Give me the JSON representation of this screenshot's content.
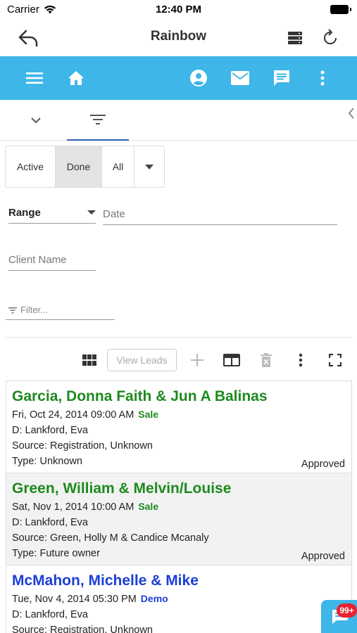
{
  "status_bar": {
    "carrier": "Carrier",
    "time": "12:40 PM"
  },
  "navbar": {
    "title": "Rainbow",
    "icons": [
      "back-icon",
      "server-icon",
      "refresh-icon"
    ]
  },
  "toolbar": {
    "icons": [
      "menu-icon",
      "home-icon",
      "account-icon",
      "mail-icon",
      "message-icon",
      "more-vertical-icon"
    ]
  },
  "tabs": {
    "icons": [
      "chevron-down-icon",
      "filter-icon"
    ]
  },
  "segment": {
    "options": [
      "Active",
      "Done",
      "All"
    ],
    "selected": "Done"
  },
  "form": {
    "range_label": "Range",
    "date_placeholder": "Date",
    "client_name_placeholder": "Client Name",
    "filter_placeholder": "Filter..."
  },
  "actions": {
    "view_leads_label": "View Leads"
  },
  "leads": [
    {
      "name": "Garcia, Donna Faith & Jun A Balinas",
      "date": "Fri, Oct 24, 2014 09:00 AM",
      "tag": "Sale",
      "d": "D: Lankford, Eva",
      "source": "Source: Registration, Unknown",
      "type": "Type: Unknown",
      "status": "Approved",
      "color": "#1e8a1e"
    },
    {
      "name": "Green, William & Melvin/Louise",
      "date": "Sat, Nov 1, 2014 10:00 AM",
      "tag": "Sale",
      "d": "D: Lankford, Eva",
      "source": "Source: Green, Holly M & Candice Mcanaly",
      "type": "Type: Future owner",
      "status": "Approved",
      "color": "#1e8a1e"
    },
    {
      "name": "McMahon, Michelle & Mike",
      "date": "Tue, Nov 4, 2014 05:30 PM",
      "tag": "Demo",
      "d": "D: Lankford, Eva",
      "source": "Source: Registration, Unknown",
      "type": "",
      "status": "",
      "color": "#1c3fd6"
    }
  ],
  "chat": {
    "badge": "99+"
  },
  "colors": {
    "accent": "#3eb6e8",
    "tab_indicator": "#2f62b8"
  }
}
